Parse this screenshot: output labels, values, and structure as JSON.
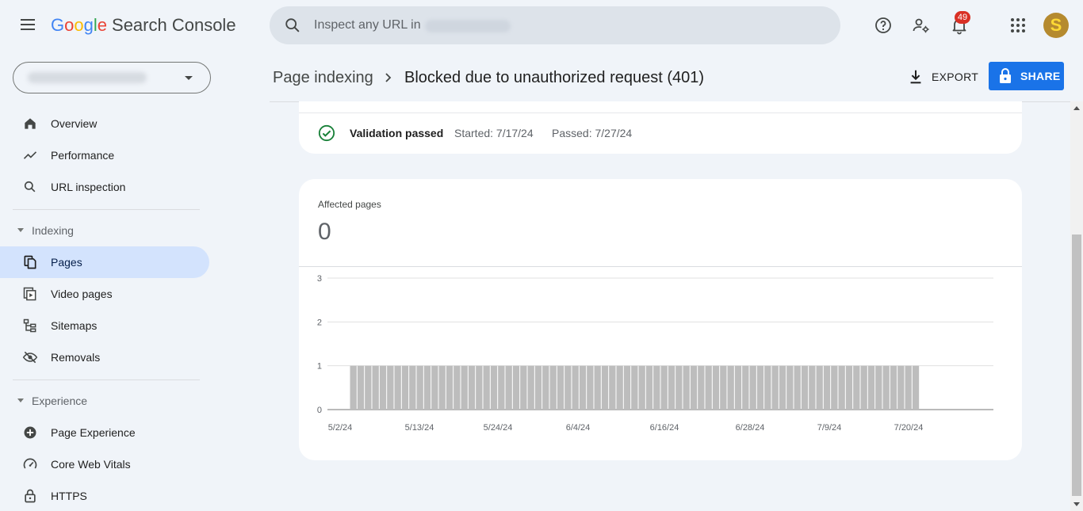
{
  "app": {
    "logo_parts": [
      "G",
      "o",
      "o",
      "g",
      "l",
      "e"
    ],
    "product": "Search Console"
  },
  "search": {
    "placeholder": "Inspect any URL in"
  },
  "notifications": {
    "count": "49"
  },
  "avatar": {
    "letter": "S"
  },
  "sidebar": {
    "top_items": [
      {
        "label": "Overview",
        "icon": "home-icon"
      },
      {
        "label": "Performance",
        "icon": "trending-up-icon"
      },
      {
        "label": "URL inspection",
        "icon": "search-icon"
      }
    ],
    "sections": [
      {
        "title": "Indexing",
        "items": [
          {
            "label": "Pages",
            "icon": "pages-icon",
            "active": true
          },
          {
            "label": "Video pages",
            "icon": "video-pages-icon"
          },
          {
            "label": "Sitemaps",
            "icon": "sitemap-icon"
          },
          {
            "label": "Removals",
            "icon": "eye-off-icon"
          }
        ]
      },
      {
        "title": "Experience",
        "items": [
          {
            "label": "Page Experience",
            "icon": "plus-circle-icon"
          },
          {
            "label": "Core Web Vitals",
            "icon": "speedometer-icon"
          },
          {
            "label": "HTTPS",
            "icon": "lock-icon"
          }
        ]
      }
    ]
  },
  "page": {
    "breadcrumb_parent": "Page indexing",
    "breadcrumb_current": "Blocked due to unauthorized request (401)",
    "export_label": "EXPORT",
    "share_label": "SHARE"
  },
  "validation": {
    "status": "Validation passed",
    "started": "Started: 7/17/24",
    "passed": "Passed: 7/27/24"
  },
  "affected": {
    "label": "Affected pages",
    "value": "0"
  },
  "colors": {
    "accent": "#1a73e8",
    "bar": "#bdbdbd",
    "success": "#188038",
    "badge": "#d93025"
  },
  "chart_data": {
    "type": "bar",
    "xlabel": "",
    "ylabel": "",
    "ylim": [
      0,
      3
    ],
    "yticks": [
      0,
      1,
      2,
      3
    ],
    "xticks": [
      "5/2/24",
      "5/13/24",
      "5/24/24",
      "6/4/24",
      "6/16/24",
      "6/28/24",
      "7/9/24",
      "7/20/24"
    ],
    "start_date": "5/2/24",
    "end_date": "7/30/24",
    "series": [
      {
        "values": [
          0,
          0,
          0,
          1,
          1,
          1,
          1,
          1,
          1,
          1,
          1,
          1,
          1,
          1,
          1,
          1,
          1,
          1,
          1,
          1,
          1,
          1,
          1,
          1,
          1,
          1,
          1,
          1,
          1,
          1,
          1,
          1,
          1,
          1,
          1,
          1,
          1,
          1,
          1,
          1,
          1,
          1,
          1,
          1,
          1,
          1,
          1,
          1,
          1,
          1,
          1,
          1,
          1,
          1,
          1,
          1,
          1,
          1,
          1,
          1,
          1,
          1,
          1,
          1,
          1,
          1,
          1,
          1,
          1,
          1,
          1,
          1,
          1,
          1,
          1,
          1,
          1,
          1,
          1,
          1,
          0,
          0,
          0,
          0,
          0,
          0,
          0,
          0,
          0,
          0
        ]
      }
    ],
    "grid": true
  }
}
